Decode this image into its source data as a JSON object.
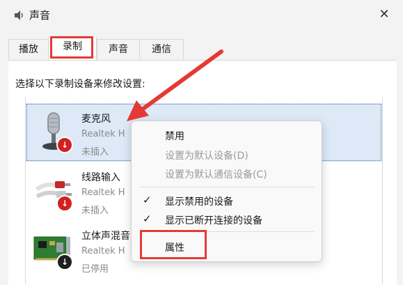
{
  "window": {
    "title": "声音",
    "close_glyph": "✕"
  },
  "tabs": [
    {
      "label": "播放"
    },
    {
      "label": "录制"
    },
    {
      "label": "声音"
    },
    {
      "label": "通信"
    }
  ],
  "active_tab": "录制",
  "instruction": "选择以下录制设备来修改设置:",
  "devices": [
    {
      "name": "麦克风",
      "vendor": "Realtek H",
      "status": "未插入",
      "icon": "microphone-icon",
      "badge": "disconnected-red"
    },
    {
      "name": "线路输入",
      "vendor": "Realtek H",
      "status": "未插入",
      "icon": "line-in-cable-icon",
      "badge": "disconnected-red"
    },
    {
      "name": "立体声混音",
      "vendor": "Realtek H",
      "status": "已停用",
      "icon": "sound-card-icon",
      "badge": "disabled-black"
    }
  ],
  "device_name_visible": [
    "麦克风",
    "线路输入",
    "立体声混音"
  ],
  "context_menu": {
    "items": [
      {
        "label": "禁用",
        "enabled": true,
        "checked": false
      },
      {
        "label": "设置为默认设备(D)",
        "enabled": false,
        "checked": false
      },
      {
        "label": "设置为默认通信设备(C)",
        "enabled": false,
        "checked": false
      },
      {
        "label": "显示禁用的设备",
        "enabled": true,
        "checked": true
      },
      {
        "label": "显示已断开连接的设备",
        "enabled": true,
        "checked": true
      },
      {
        "label": "属性",
        "enabled": true,
        "checked": false
      }
    ]
  },
  "annotations": {
    "highlight_color": "#e53935",
    "arrow_color": "#e53935"
  },
  "colors": {
    "selection": "#dde9f7",
    "badge_red": "#d32020",
    "badge_dark": "#202020"
  }
}
